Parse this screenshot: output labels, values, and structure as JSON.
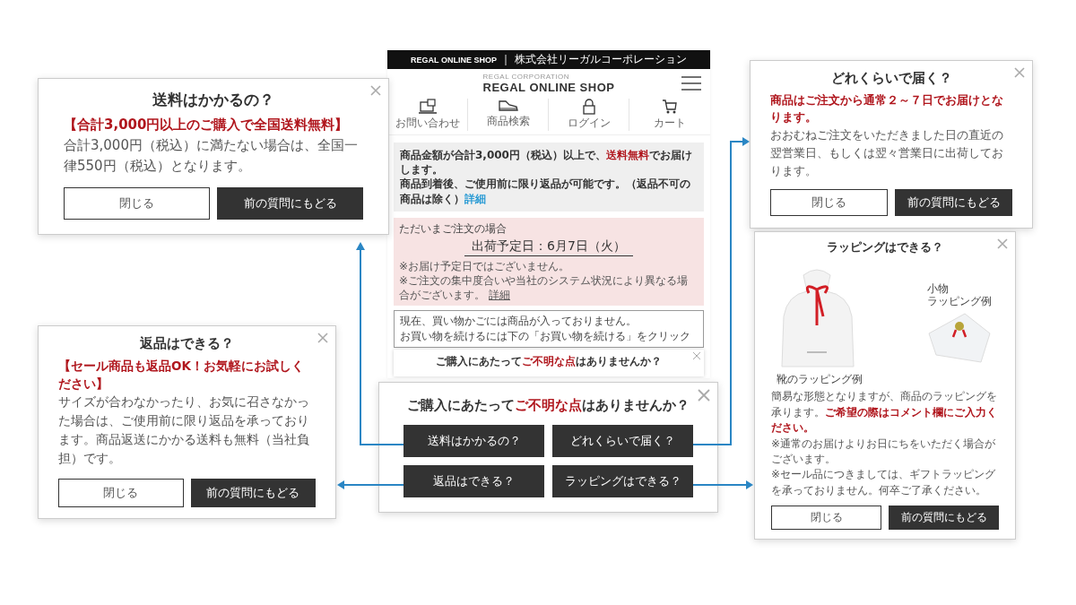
{
  "phone": {
    "top_bar": {
      "shop": "REGAL ONLINE SHOP",
      "separator": "｜",
      "company": "株式会社リーガルコーポレーション"
    },
    "brand_small": "REGAL CORPORATION",
    "brand": "REGAL ONLINE SHOP",
    "nav": [
      {
        "kind": "contact",
        "label": "お問い合わせ"
      },
      {
        "kind": "search",
        "label": "商品検索"
      },
      {
        "kind": "login",
        "label": "ログイン"
      },
      {
        "kind": "cart",
        "label": "カート"
      }
    ],
    "notice": {
      "lines": [
        "商品金額が合計3,000円（税込）以上で、**送料無料**でお届けします。",
        "商品到着後、ご使用前に限り返品が可能です。（返品不可の商品は除く）"
      ],
      "link": "詳細"
    },
    "shipping": {
      "label": "ただいまご注文の場合",
      "date": "出荷予定日：6月7日（火）",
      "notes": [
        "※お届け予定日ではございません。",
        "※ご注文の集中度合いや当社のシステム状況により異なる場合がございます。"
      ],
      "link": "詳細"
    },
    "cart_lines": [
      "現在、買い物かごには商品が入っておりません。",
      "お買い物を続けるには下の「お買い物を続ける」をクリック"
    ],
    "mini_popup_title": "ご購入にあたって**ご不明な点**はありませんか？"
  },
  "faq_popup": {
    "title": "ご購入にあたって**ご不明な点**はありませんか？",
    "buttons": [
      "送料はかかるの？",
      "どれくらいで届く？",
      "返品はできる？",
      "ラッピングはできる？"
    ]
  },
  "answers": [
    {
      "kind": "text",
      "title": "送料はかかるの？",
      "highlight": "【合計3,000円以上のご購入で全国送料無料】",
      "body": "合計3,000円（税込）に満たない場合は、全国一律550円（税込）となります。",
      "buttons": [
        "閉じる",
        "前の質問にもどる"
      ]
    },
    {
      "kind": "text",
      "title": "どれくらいで届く？",
      "highlight": "商品はご注文から通常２～７日でお届けとなります。",
      "body": "おおむねご注文をいただきました日の直近の翌営業日、もしくは翌々営業日に出荷しております。",
      "buttons": [
        "閉じる",
        "前の質問にもどる"
      ]
    },
    {
      "kind": "text",
      "title": "返品はできる？",
      "highlight": "【セール商品も返品OK！お気軽にお試しください】",
      "body": "サイズが合わなかったり、お気に召さなかった場合は、ご使用前に限り返品を承っております。商品返送にかかる送料も無料（当社負担）です。",
      "buttons": [
        "閉じる",
        "前の質問にもどる"
      ]
    },
    {
      "kind": "wrapping",
      "title": "ラッピングはできる？",
      "captions": [
        [
          "靴のラッピング例"
        ],
        [
          "小物",
          "ラッピング例"
        ]
      ],
      "body": "簡易な形態となりますが、商品のラッピングを承ります。**ご希望の際はコメント欄にご入力ください。**",
      "notes": [
        "※通常のお届けよりお日にちをいただく場合がございます。",
        "※セール品につきましては、ギフトラッピングを承っておりません。何卒ご了承ください。"
      ],
      "buttons": [
        "閉じる",
        "前の質問にもどる"
      ]
    }
  ]
}
